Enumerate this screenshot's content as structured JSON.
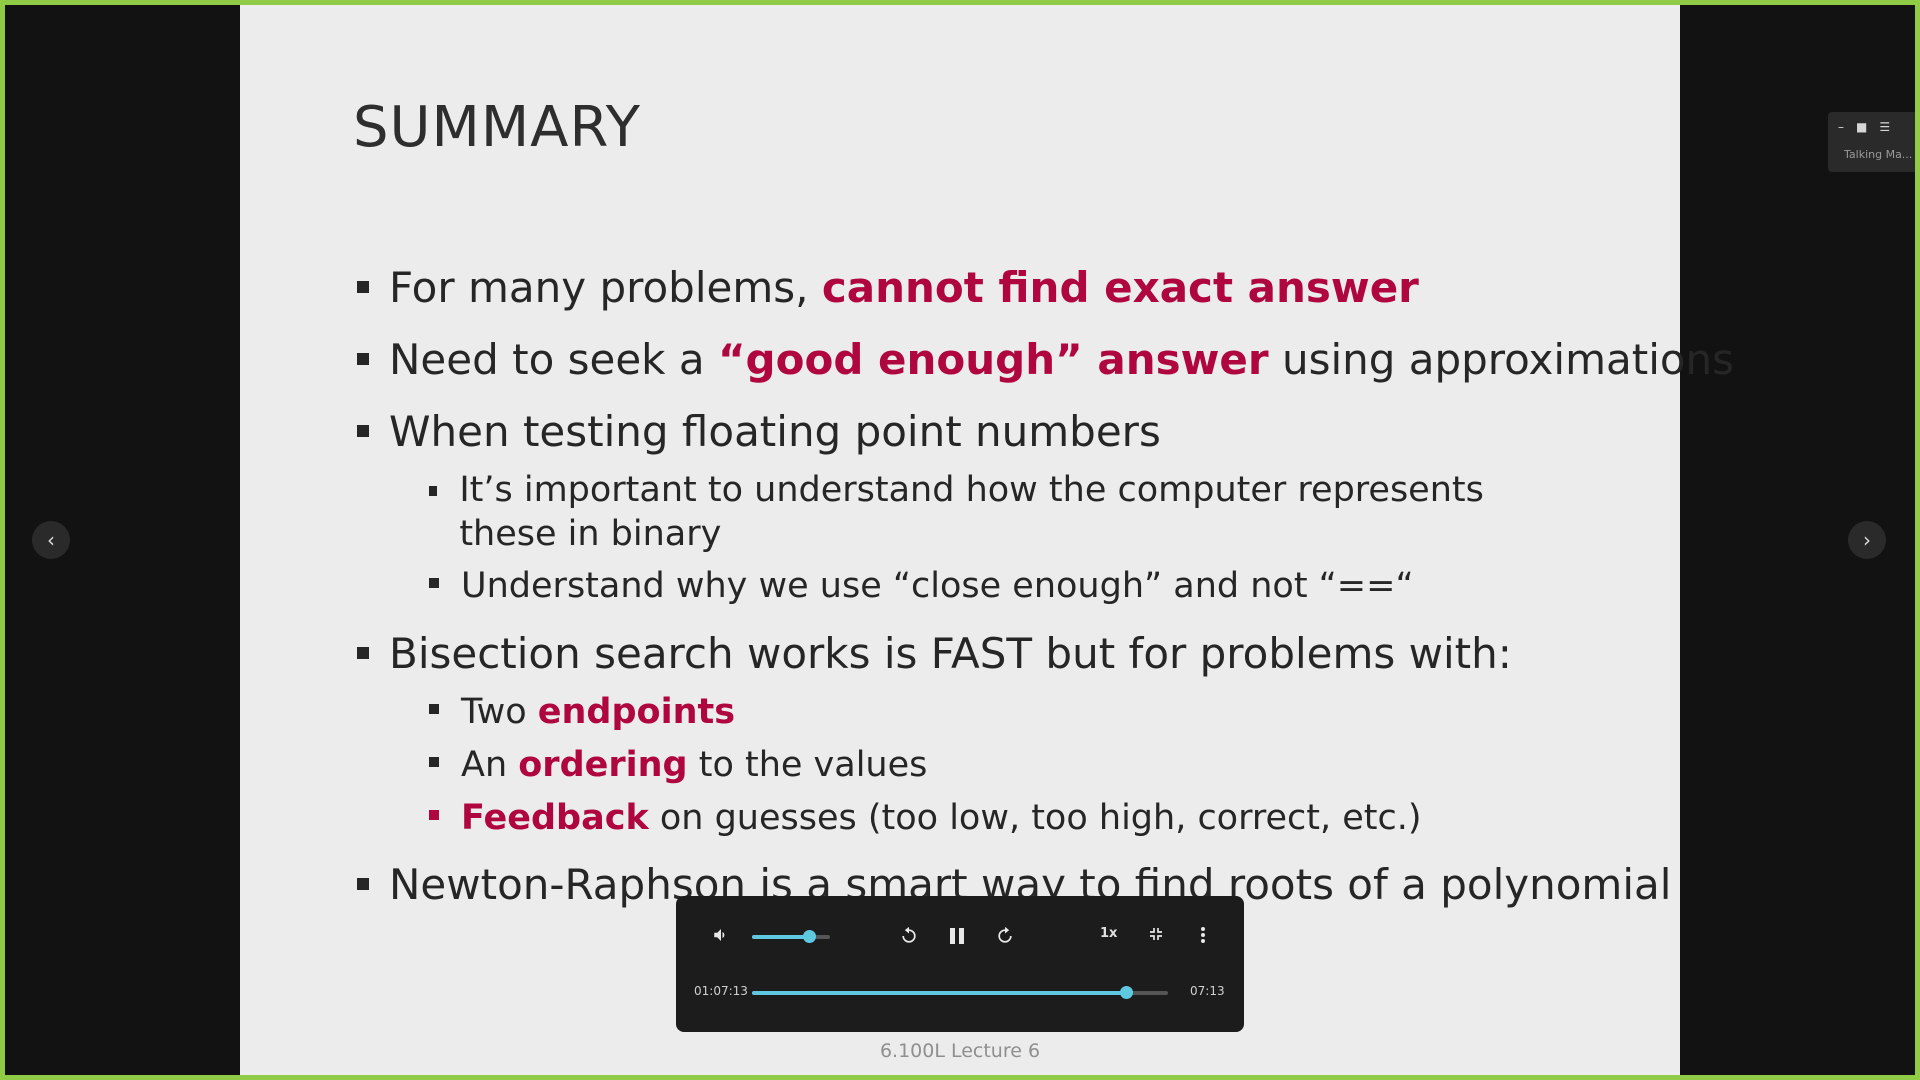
{
  "slide": {
    "title": "SUMMARY",
    "b1_text": "For many problems, ",
    "b1_hl": "cannot find exact answer",
    "b2_pre": "Need to seek a ",
    "b2_hl": "“good enough” answer",
    "b2_post": " using approximations",
    "b3": "When testing floating point numbers",
    "b3_sub1": "It’s important to understand how the computer represents these in binary",
    "b3_sub2": "Understand why we use “close enough” and not “==“",
    "b4": "Bisection search works is FAST but for problems with:",
    "b4_sub1_pre": "Two ",
    "b4_sub1_hl": "endpoints",
    "b4_sub2_pre": "An ",
    "b4_sub2_hl": "ordering",
    "b4_sub2_post": " to the values",
    "b4_sub3_hl": "Feedback",
    "b4_sub3_post": " on guesses (too low, too high, correct, etc.)",
    "b5": "Newton-Raphson is a smart way to find roots of a polynomial",
    "footer": "6.100L Lecture 6"
  },
  "nav": {
    "prev_icon": "chevron-left-icon",
    "next_icon": "chevron-right-icon",
    "prev_glyph": "‹",
    "next_glyph": "›"
  },
  "mini_widget": {
    "icons": [
      "minimize-icon",
      "video-icon",
      "list-icon"
    ],
    "label": "Talking Ma..."
  },
  "player": {
    "current_time": "01:07:13",
    "duration": "07:13",
    "speed": "1x",
    "volume_level": 0.73,
    "progress": 0.9,
    "icons": {
      "volume": "volume-icon",
      "rewind": "rewind-10-icon",
      "pause": "pause-icon",
      "forward": "forward-10-icon",
      "exit_fullscreen": "exit-fullscreen-icon",
      "more": "more-vertical-icon"
    },
    "accent_color": "#5ec8e0"
  },
  "colors": {
    "highlight": "#b0063f",
    "frame": "#8fcb44"
  }
}
